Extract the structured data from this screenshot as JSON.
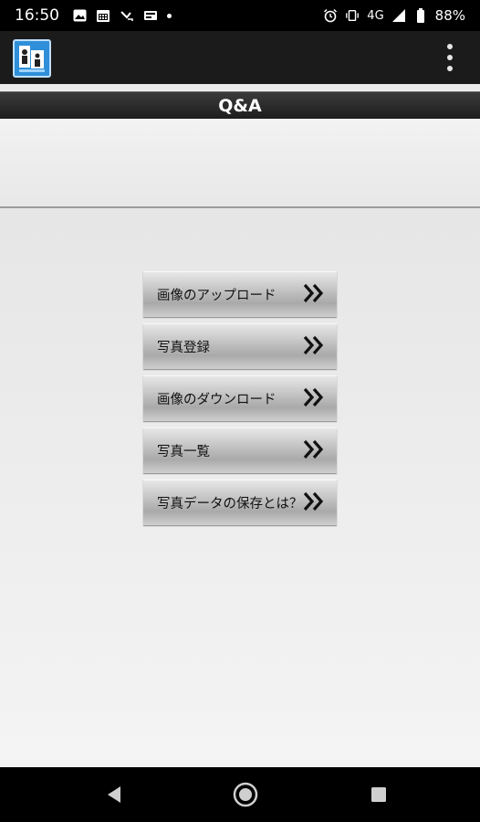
{
  "status_bar": {
    "time": "16:50",
    "network": "4G",
    "battery": "88%"
  },
  "app_bar": {
    "logo_icon": "app-logo-icon",
    "menu_icon": "overflow-menu-icon"
  },
  "page": {
    "title": "Q&A"
  },
  "menu": {
    "items": [
      {
        "label": "画像のアップロード"
      },
      {
        "label": "写真登録"
      },
      {
        "label": "画像のダウンロード"
      },
      {
        "label": "写真一覧"
      },
      {
        "label": "写真データの保存とは？"
      }
    ]
  },
  "nav": {
    "back_icon": "back-triangle-icon",
    "home_icon": "home-circle-icon",
    "recents_icon": "recents-square-icon"
  }
}
